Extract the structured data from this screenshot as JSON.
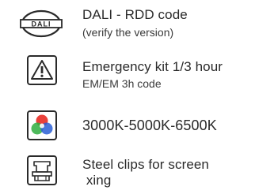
{
  "features": [
    {
      "icon": "dali-logo-icon",
      "icon_text": "DALI",
      "title": "DALI - RDD code",
      "subtitle": "(verify the version)"
    },
    {
      "icon": "emergency-warning-icon",
      "title": "Emergency kit 1/3 hour",
      "subtitle": "EM/EM 3h code"
    },
    {
      "icon": "rgb-color-temperature-icon",
      "title": "3000K-5000K-6500K",
      "colors": [
        "#e8312a",
        "#2fae3f",
        "#2a5fd6"
      ]
    },
    {
      "icon": "steel-clip-icon",
      "title": "Steel clips for screen",
      "subtitle": " xing"
    }
  ]
}
